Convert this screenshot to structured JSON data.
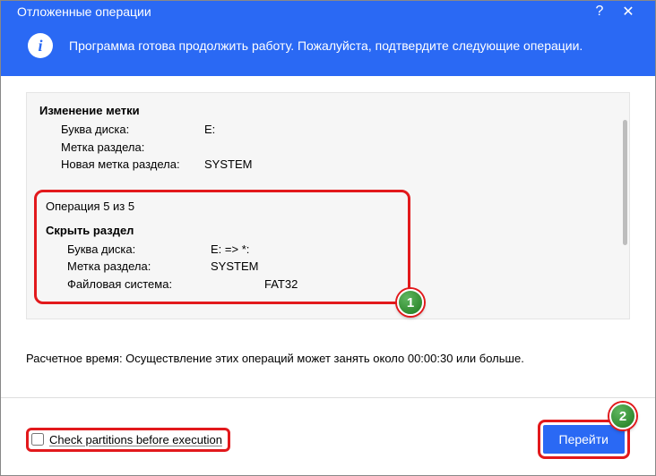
{
  "titlebar": {
    "title": "Отложенные операции"
  },
  "infobar": {
    "message": "Программа готова продолжить работу. Пожалуйста, подтвердите следующие операции."
  },
  "op_a": {
    "title": "Изменение метки",
    "rows": [
      {
        "k": "Буква диска:",
        "v": "E:"
      },
      {
        "k": "Метка раздела:",
        "v": ""
      },
      {
        "k": "Новая метка раздела:",
        "v": "SYSTEM"
      }
    ]
  },
  "op_count": "Операция 5 из 5",
  "op_b": {
    "title": "Скрыть раздел",
    "rows": [
      {
        "k": "Буква диска:",
        "v": "E: => *:"
      },
      {
        "k": "Метка раздела:",
        "v": "SYSTEM"
      },
      {
        "k": "Файловая система:",
        "v": "FAT32"
      }
    ]
  },
  "est_time": "Расчетное время: Осуществление этих операций может занять около 00:00:30 или больше.",
  "bottom": {
    "checkbox_label": "Check partitions before execution",
    "go_label": "Перейти"
  },
  "callouts": {
    "one": "1",
    "two": "2"
  }
}
